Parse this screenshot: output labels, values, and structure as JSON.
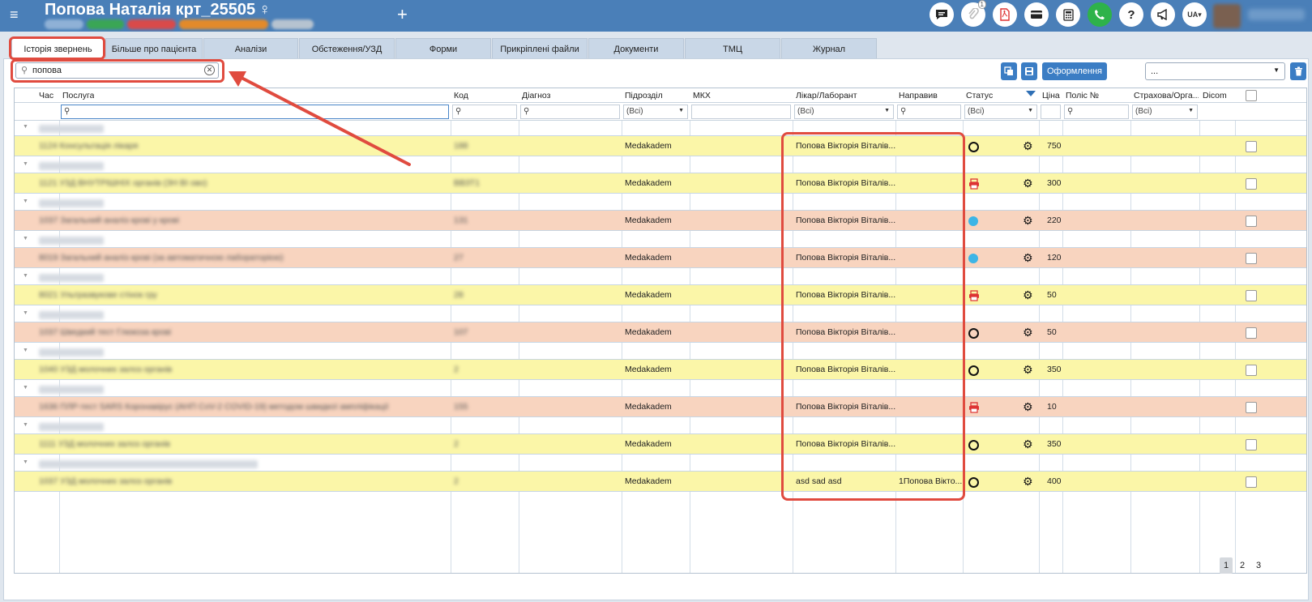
{
  "header": {
    "patient_title": "Попова Наталія крт_25505",
    "gender_icon": "♀",
    "menu_icon": "hamburger-icon",
    "add_icon": "plus-icon",
    "lang": "UA",
    "notification_count": "1",
    "toolbar_icons": [
      "chat-icon",
      "attachment-icon",
      "pdf-icon",
      "payment-card-icon",
      "calculator-icon",
      "phone-icon",
      "help-icon",
      "megaphone-icon"
    ]
  },
  "tabs": [
    {
      "label": "Історія звернень",
      "active": true
    },
    {
      "label": "Більше про пацієнта"
    },
    {
      "label": "Аналізи"
    },
    {
      "label": "Обстеження/УЗД"
    },
    {
      "label": "Форми"
    },
    {
      "label": "Прикріплені файли"
    },
    {
      "label": "Документи"
    },
    {
      "label": "ТМЦ"
    },
    {
      "label": "Журнал"
    }
  ],
  "search": {
    "value": "попова"
  },
  "actions": {
    "oformlennya_label": "Оформлення",
    "select_value": "..."
  },
  "columns": [
    "Час",
    "Послуга",
    "Код",
    "Діагноз",
    "Підрозділ",
    "МКХ",
    "Лікар/Лаборант",
    "Направив",
    "Статус",
    "Ціна",
    "Поліс №",
    "Страхова/Орга...",
    "Dicom"
  ],
  "filters": {
    "department": "(Всі)",
    "doctor": "(Всі)",
    "status": "(Всі)",
    "insurance": "(Всі)"
  },
  "rows": [
    {
      "color": "yellow",
      "department": "Medakadem",
      "doctor": "Попова Вікторія Віталів...",
      "referrer": "",
      "status": "circle",
      "price": "750"
    },
    {
      "color": "yellow",
      "department": "Medakadem",
      "doctor": "Попова Вікторія Віталів...",
      "referrer": "",
      "status": "print",
      "price": "300"
    },
    {
      "color": "salmon",
      "department": "Medakadem",
      "doctor": "Попова Вікторія Віталів...",
      "referrer": "",
      "status": "dot",
      "price": "220"
    },
    {
      "color": "salmon",
      "department": "Medakadem",
      "doctor": "Попова Вікторія Віталів...",
      "referrer": "",
      "status": "dot",
      "price": "120"
    },
    {
      "color": "yellow",
      "department": "Medakadem",
      "doctor": "Попова Вікторія Віталів...",
      "referrer": "",
      "status": "print",
      "price": "50"
    },
    {
      "color": "salmon",
      "department": "Medakadem",
      "doctor": "Попова Вікторія Віталів...",
      "referrer": "",
      "status": "circle",
      "price": "50"
    },
    {
      "color": "yellow",
      "department": "Medakadem",
      "doctor": "Попова Вікторія Віталів...",
      "referrer": "",
      "status": "circle",
      "price": "350"
    },
    {
      "color": "salmon",
      "department": "Medakadem",
      "doctor": "Попова Вікторія Віталів...",
      "referrer": "",
      "status": "print",
      "price": "10"
    },
    {
      "color": "yellow",
      "department": "Medakadem",
      "doctor": "Попова Вікторія Віталів...",
      "referrer": "",
      "status": "circle",
      "price": "350"
    },
    {
      "color": "yellow",
      "department": "Medakadem",
      "doctor": "asd sad asd",
      "referrer": "1Попова Вікто...",
      "status": "circle",
      "price": "400"
    }
  ],
  "pager": {
    "pages": [
      "1",
      "2",
      "3"
    ],
    "current": "1"
  }
}
